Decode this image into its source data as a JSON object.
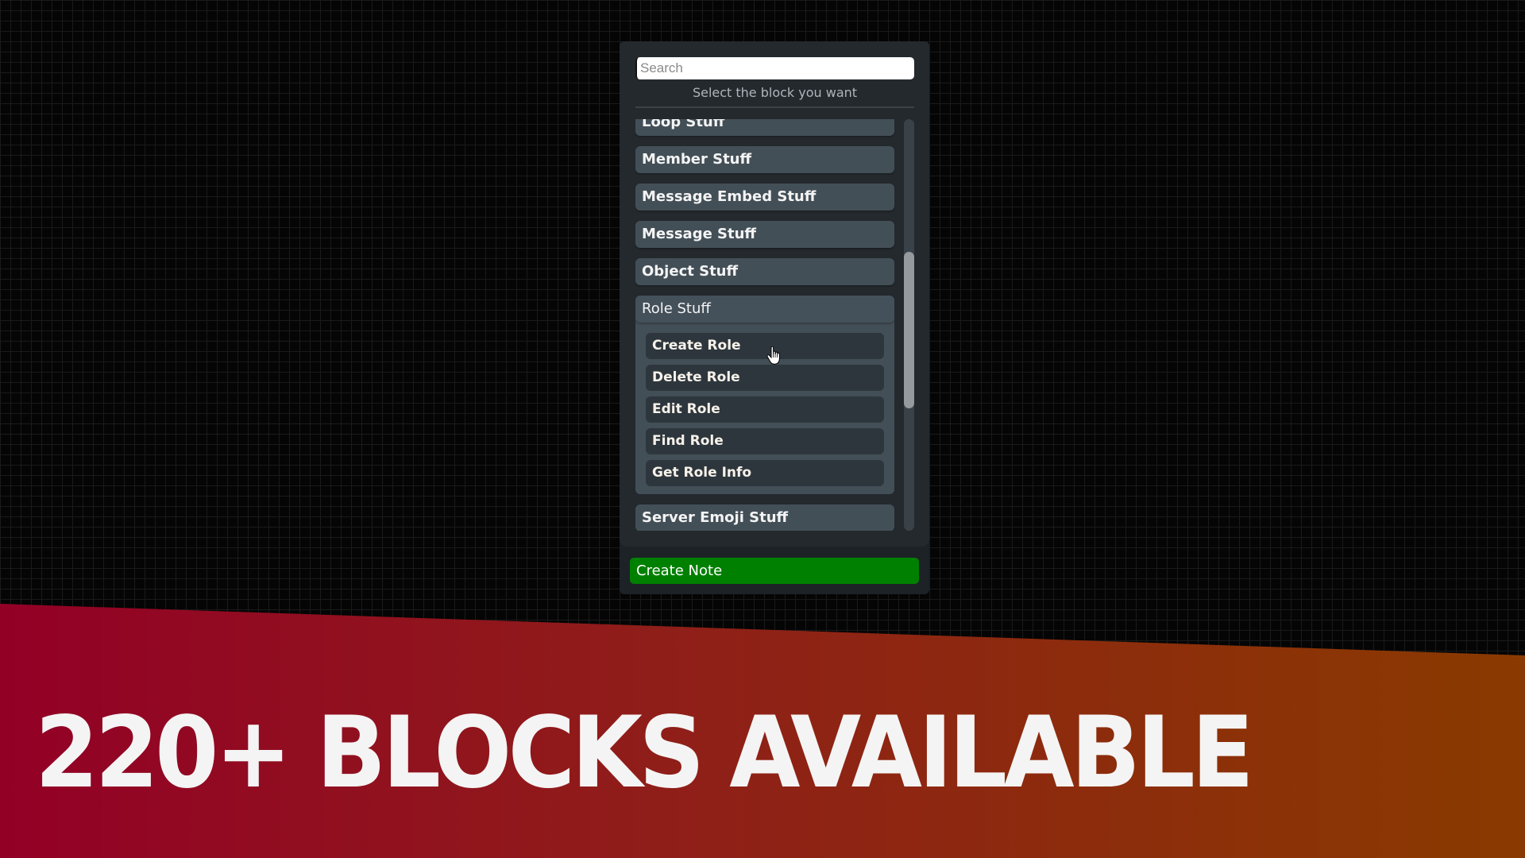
{
  "picker": {
    "search_placeholder": "Search",
    "search_value": "",
    "subtitle": "Select the block you want",
    "categories_before": [
      {
        "label": "Loop Stuff"
      },
      {
        "label": "Member Stuff"
      },
      {
        "label": "Message Embed Stuff"
      },
      {
        "label": "Message Stuff"
      },
      {
        "label": "Object Stuff"
      }
    ],
    "expanded_category": {
      "label": "Role Stuff",
      "items": [
        {
          "label": "Create Role"
        },
        {
          "label": "Delete Role"
        },
        {
          "label": "Edit Role"
        },
        {
          "label": "Find Role"
        },
        {
          "label": "Get Role Info"
        }
      ]
    },
    "categories_after": [
      {
        "label": "Server Emoji Stuff"
      }
    ],
    "scroll_position_fraction": 0.52,
    "scroll_visible_fraction": 0.38,
    "create_note_label": "Create Note"
  },
  "banner": {
    "headline": "220+ BLOCKS AVAILABLE",
    "gradient_start": "#930026",
    "gradient_end": "#8a3a00"
  },
  "colors": {
    "create_note_button": "#008000",
    "category_item": "#434f57",
    "sub_item": "#2e363d"
  }
}
